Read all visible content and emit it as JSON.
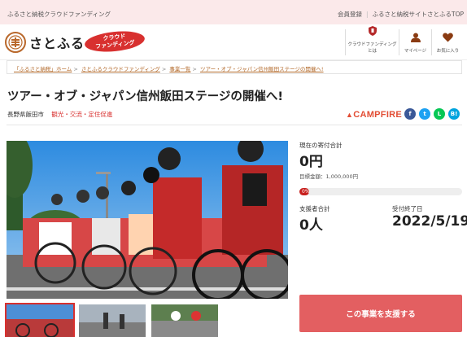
{
  "topbar": {
    "left_text": "ふるさと納税クラウドファンディング",
    "links": [
      "会員登録",
      "ふるさと納税サイトさとふるTOP"
    ]
  },
  "header": {
    "logo_text": "さとふる",
    "badge_line1": "クラウド",
    "badge_line2": "ファンディング",
    "nav": [
      {
        "label": "クラウドファンディングとは",
        "icon": "shield-icon"
      },
      {
        "label": "マイページ",
        "icon": "user-icon"
      },
      {
        "label": "お気に入り",
        "icon": "heart-icon"
      }
    ]
  },
  "breadcrumb": [
    "「ふるさと納税」ホーム",
    "さとふるクラウドファンディング",
    "事業一覧",
    "ツアー・オブ・ジャパン信州飯田ステージの開催へ!"
  ],
  "project": {
    "title": "ツアー・オブ・ジャパン信州飯田ステージの開催へ!",
    "region": "長野県飯田市",
    "tags": "観光・交流・定住促進",
    "partner": "CAMPFIRE"
  },
  "stats": {
    "donation_label": "現在の寄付合計",
    "donation_value": "0円",
    "goal_text": "目標金額：1,000,000円",
    "progress_pct": 0,
    "progress_label": "0%",
    "supporters_label": "支援者合計",
    "supporters_value": "0人",
    "deadline_label": "受付終了日",
    "deadline_value": "2022/5/19"
  },
  "cta": {
    "support_label": "この事業を支援する"
  },
  "colors": {
    "accent": "#d8302f",
    "button": "#e35f61",
    "topbar": "#fbe9ea"
  }
}
